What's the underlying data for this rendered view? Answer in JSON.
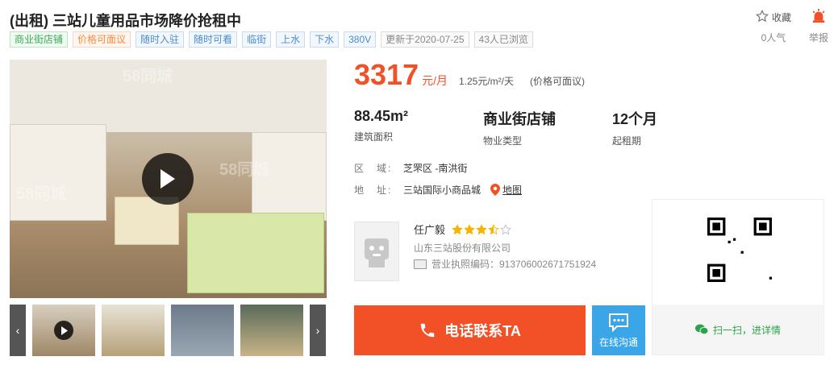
{
  "listing": {
    "title": "(出租) 三站儿童用品市场降价抢租中",
    "tags": [
      {
        "label": "商业街店铺",
        "style": "green"
      },
      {
        "label": "价格可面议",
        "style": "orange"
      },
      {
        "label": "随时入驻",
        "style": "blue"
      },
      {
        "label": "随时可看",
        "style": "blue"
      },
      {
        "label": "临街",
        "style": "blue"
      },
      {
        "label": "上水",
        "style": "blue"
      },
      {
        "label": "下水",
        "style": "blue"
      },
      {
        "label": "380V",
        "style": "blue"
      },
      {
        "label": "更新于2020-07-25",
        "style": "grey"
      },
      {
        "label": "43人已浏览",
        "style": "grey"
      }
    ]
  },
  "actions": {
    "favorite_label": "收藏",
    "favorite_count": "0人气",
    "report_label": "举报"
  },
  "gallery": {
    "watermark": "58同城",
    "thumb_count": 4
  },
  "price": {
    "amount": "3317",
    "unit": "元/月",
    "per_area": "1.25元/m²/天",
    "note": "(价格可面议)"
  },
  "facts": [
    {
      "value": "88.45m²",
      "label": "建筑面积"
    },
    {
      "value": "商业街店铺",
      "label": "物业类型"
    },
    {
      "value": "12个月",
      "label": "起租期"
    }
  ],
  "location": {
    "district_key": "区　域:",
    "district": "芝罘区 -南洪街",
    "address_key": "地　址:",
    "address": "三站国际小商品城",
    "map_label": "地图"
  },
  "agent": {
    "name": "任广毅",
    "rating": 3.5,
    "rating_max": 5,
    "company": "山东三站股份有限公司",
    "license": "营业执照编码：913706002671751924"
  },
  "buttons": {
    "call_label": "电话联系TA",
    "chat_label": "在线沟通"
  },
  "qr": {
    "caption": "扫一扫，进详情"
  },
  "colors": {
    "accent": "#f25128",
    "chat": "#3aa6e8",
    "green": "#2aa34a"
  }
}
